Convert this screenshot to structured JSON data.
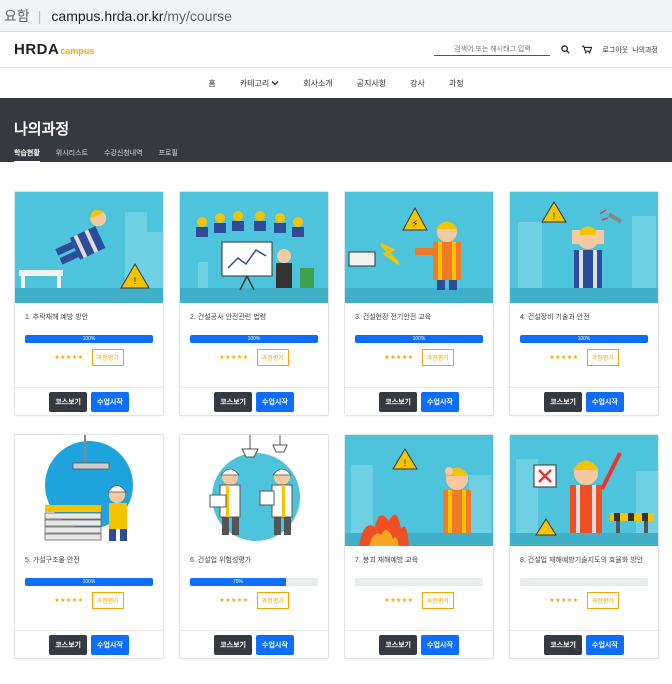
{
  "browser": {
    "left_text": "요함",
    "url_host": "campus.hrda.or.kr",
    "url_path": "/my/course"
  },
  "header": {
    "logo_main": "HRDA",
    "logo_sub": "campus",
    "search_placeholder": "검색어 또는 해시태그 입력",
    "logout": "로그아웃",
    "my_courses": "나의과정"
  },
  "nav": {
    "items": [
      "홈",
      "카테고리",
      "회사소개",
      "공지사항",
      "강사",
      "과정"
    ]
  },
  "page": {
    "title": "나의과정",
    "tabs": [
      "학습현황",
      "위시리스트",
      "수강신청내역",
      "프로필"
    ]
  },
  "card_labels": {
    "stars": "★★★★★",
    "eval": "과정평가",
    "view": "코스보기",
    "start": "수업시작"
  },
  "courses": [
    {
      "title": "1. 추락재해 예방 방안",
      "progress": 100,
      "progress_label": "100%"
    },
    {
      "title": "2. 건설공사 안전관련 법령",
      "progress": 100,
      "progress_label": "100%"
    },
    {
      "title": "3. 건설현장 전기안전 교육",
      "progress": 100,
      "progress_label": "100%"
    },
    {
      "title": "4. 건설장비 기술과 안전",
      "progress": 100,
      "progress_label": "100%"
    },
    {
      "title": "5. 가설구조물 안전",
      "progress": 100,
      "progress_label": "100%"
    },
    {
      "title": "6. 건설업 위험성평가",
      "progress": 75,
      "progress_label": "75%"
    },
    {
      "title": "7. 붕괴 재해예방 교육",
      "progress": 0,
      "progress_label": ""
    },
    {
      "title": "8. 건설업 재해예방기술지도의 효율화 방안",
      "progress": 0,
      "progress_label": ""
    }
  ],
  "colors": {
    "accent": "#0d6efd",
    "dark": "#343a40",
    "star": "#f0a500",
    "image_bg": "#4ec3dc"
  }
}
